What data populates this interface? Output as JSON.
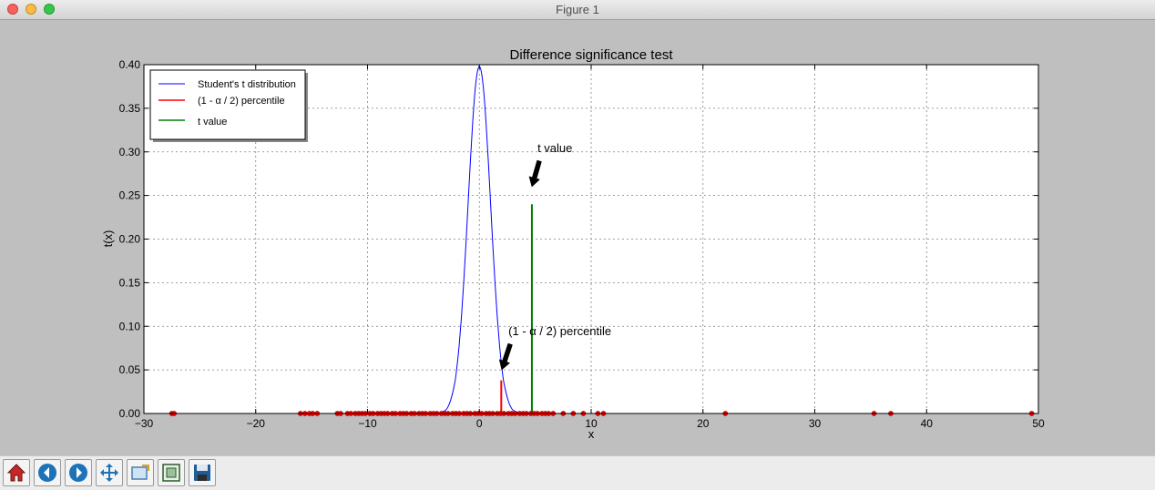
{
  "window": {
    "title": "Figure 1"
  },
  "toolbar": {
    "buttons": [
      {
        "name": "home-button",
        "icon": "home-icon"
      },
      {
        "name": "back-button",
        "icon": "back-arrow-icon"
      },
      {
        "name": "forward-button",
        "icon": "forward-arrow-icon"
      },
      {
        "name": "pan-button",
        "icon": "pan-arrows-icon"
      },
      {
        "name": "zoom-rect-button",
        "icon": "zoom-rect-icon"
      },
      {
        "name": "subplots-button",
        "icon": "subplots-icon"
      },
      {
        "name": "save-button",
        "icon": "save-disk-icon"
      }
    ]
  },
  "chart_data": {
    "type": "line",
    "title": "Difference significance test",
    "xlabel": "x",
    "ylabel": "t(x)",
    "xlim": [
      -30,
      50
    ],
    "ylim": [
      0,
      0.4
    ],
    "xticks": [
      -30,
      -20,
      -10,
      0,
      10,
      20,
      30,
      40,
      50
    ],
    "xtick_labels": [
      "−30",
      "−20",
      "−10",
      "0",
      "10",
      "20",
      "30",
      "40",
      "50"
    ],
    "yticks": [
      0,
      0.05,
      0.1,
      0.15,
      0.2,
      0.25,
      0.3,
      0.35,
      0.4
    ],
    "ytick_labels": [
      "0.00",
      "0.05",
      "0.10",
      "0.15",
      "0.20",
      "0.25",
      "0.30",
      "0.35",
      "0.40"
    ],
    "grid": true,
    "legend": {
      "position": "top-left",
      "entries": [
        {
          "label": "Student's t distribution",
          "color": "#0000ff"
        },
        {
          "label": "(1 - α / 2) percentile",
          "color": "#ff0000"
        },
        {
          "label": "t value",
          "color": "#008000"
        }
      ]
    },
    "series": [
      {
        "kind": "curve",
        "color": "#0000ff",
        "x": [
          -3.6,
          -3.0,
          -2.6,
          -2.2,
          -2.0,
          -1.8,
          -1.6,
          -1.4,
          -1.2,
          -1.0,
          -0.8,
          -0.6,
          -0.4,
          -0.2,
          0.0,
          0.2,
          0.4,
          0.6,
          0.8,
          1.0,
          1.2,
          1.4,
          1.6,
          1.8,
          2.0,
          2.2,
          2.6,
          3.0,
          3.6
        ],
        "y": [
          0.001,
          0.004,
          0.014,
          0.035,
          0.054,
          0.079,
          0.111,
          0.15,
          0.194,
          0.242,
          0.29,
          0.333,
          0.368,
          0.39,
          0.398,
          0.39,
          0.368,
          0.333,
          0.29,
          0.242,
          0.194,
          0.15,
          0.111,
          0.079,
          0.054,
          0.035,
          0.014,
          0.004,
          0.001
        ]
      },
      {
        "kind": "vline",
        "color": "#ff0000",
        "x": 1.96,
        "y": 0.038
      },
      {
        "kind": "vline",
        "color": "#008000",
        "x": 4.7,
        "y": 0.24
      },
      {
        "kind": "rug",
        "color": "#ff0000",
        "x": [
          -27.5,
          -27.3,
          -16,
          -15.6,
          -15.2,
          -14.9,
          -14.5,
          -12.7,
          -12.4,
          -11.8,
          -11.5,
          -11.1,
          -10.8,
          -10.5,
          -10.2,
          -9.8,
          -9.5,
          -9.1,
          -8.8,
          -8.5,
          -8.2,
          -7.8,
          -7.5,
          -7.1,
          -6.8,
          -6.5,
          -6.1,
          -5.8,
          -5.4,
          -5.1,
          -4.8,
          -4.4,
          -4.1,
          -3.8,
          -3.4,
          -3.1,
          -2.8,
          -2.4,
          -2.1,
          -1.8,
          -1.4,
          -1.1,
          -0.8,
          -0.4,
          -0.1,
          0.2,
          0.6,
          0.9,
          1.2,
          1.6,
          1.9,
          2.2,
          2.6,
          2.9,
          3.2,
          3.6,
          3.9,
          4.2,
          4.6,
          4.9,
          5.2,
          5.6,
          5.9,
          6.2,
          6.6,
          7.5,
          8.4,
          9.3,
          10.6,
          11.1,
          22,
          35.3,
          36.8,
          49.4
        ]
      }
    ],
    "annotations": [
      {
        "text": "t value",
        "x": 5.2,
        "y": 0.3,
        "arrow_to": [
          4.7,
          0.26
        ]
      },
      {
        "text": "(1 - α / 2) percentile",
        "x": 2.6,
        "y": 0.09,
        "arrow_to": [
          2.0,
          0.05
        ]
      }
    ]
  }
}
